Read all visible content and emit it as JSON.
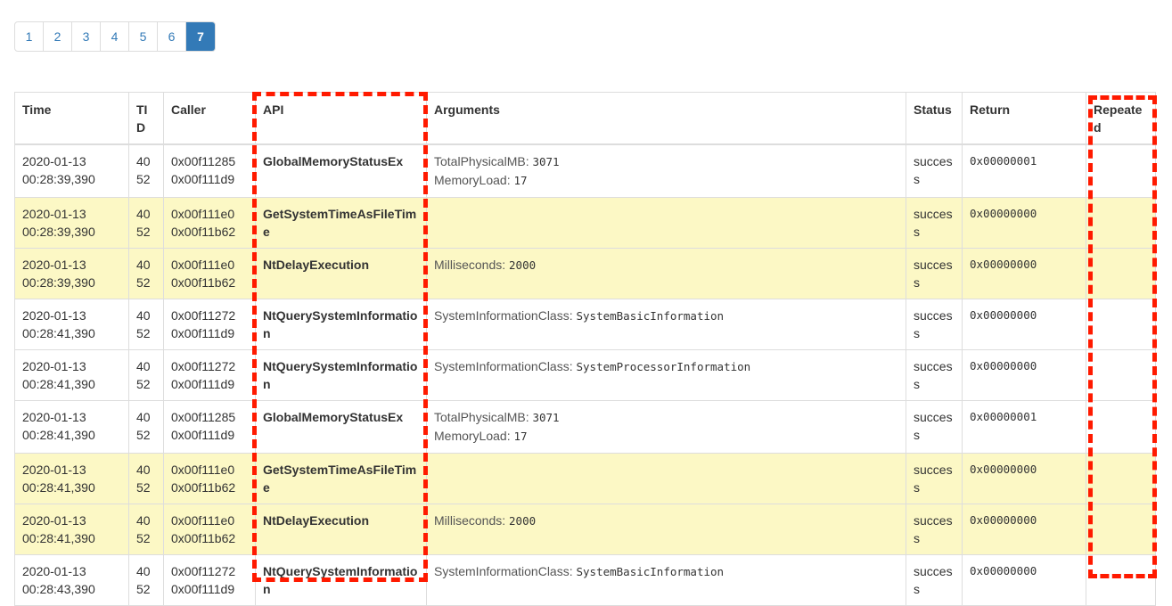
{
  "pagination": {
    "pages": [
      "1",
      "2",
      "3",
      "4",
      "5",
      "6",
      "7"
    ],
    "active": "7"
  },
  "table": {
    "headers": {
      "time": "Time",
      "tid": "TID",
      "caller": "Caller",
      "api": "API",
      "arguments": "Arguments",
      "status": "Status",
      "return": "Return",
      "repeated": "Repeated"
    },
    "rows": [
      {
        "highlight": false,
        "date": "2020-01-13",
        "time": "00:28:39,390",
        "tid_a": "40",
        "tid_b": "52",
        "caller_a": "0x00f11285",
        "caller_b": "0x00f111d9",
        "api": "GlobalMemoryStatusEx",
        "args": [
          {
            "name": "TotalPhysicalMB:",
            "value": "3071"
          },
          {
            "name": "MemoryLoad:",
            "value": "17"
          }
        ],
        "status": "success",
        "ret": "0x00000001",
        "repeated": ""
      },
      {
        "highlight": true,
        "date": "2020-01-13",
        "time": "00:28:39,390",
        "tid_a": "40",
        "tid_b": "52",
        "caller_a": "0x00f111e0",
        "caller_b": "0x00f11b62",
        "api": "GetSystemTimeAsFileTime",
        "args": [],
        "status": "success",
        "ret": "0x00000000",
        "repeated": ""
      },
      {
        "highlight": true,
        "date": "2020-01-13",
        "time": "00:28:39,390",
        "tid_a": "40",
        "tid_b": "52",
        "caller_a": "0x00f111e0",
        "caller_b": "0x00f11b62",
        "api": "NtDelayExecution",
        "args": [
          {
            "name": "Milliseconds:",
            "value": "2000"
          }
        ],
        "status": "success",
        "ret": "0x00000000",
        "repeated": ""
      },
      {
        "highlight": false,
        "date": "2020-01-13",
        "time": "00:28:41,390",
        "tid_a": "40",
        "tid_b": "52",
        "caller_a": "0x00f11272",
        "caller_b": "0x00f111d9",
        "api": "NtQuerySystemInformation",
        "args": [
          {
            "name": "SystemInformationClass:",
            "value": "SystemBasicInformation"
          }
        ],
        "status": "success",
        "ret": "0x00000000",
        "repeated": ""
      },
      {
        "highlight": false,
        "date": "2020-01-13",
        "time": "00:28:41,390",
        "tid_a": "40",
        "tid_b": "52",
        "caller_a": "0x00f11272",
        "caller_b": "0x00f111d9",
        "api": "NtQuerySystemInformation",
        "args": [
          {
            "name": "SystemInformationClass:",
            "value": "SystemProcessorInformation"
          }
        ],
        "status": "success",
        "ret": "0x00000000",
        "repeated": ""
      },
      {
        "highlight": false,
        "date": "2020-01-13",
        "time": "00:28:41,390",
        "tid_a": "40",
        "tid_b": "52",
        "caller_a": "0x00f11285",
        "caller_b": "0x00f111d9",
        "api": "GlobalMemoryStatusEx",
        "args": [
          {
            "name": "TotalPhysicalMB:",
            "value": "3071"
          },
          {
            "name": "MemoryLoad:",
            "value": "17"
          }
        ],
        "status": "success",
        "ret": "0x00000001",
        "repeated": ""
      },
      {
        "highlight": true,
        "date": "2020-01-13",
        "time": "00:28:41,390",
        "tid_a": "40",
        "tid_b": "52",
        "caller_a": "0x00f111e0",
        "caller_b": "0x00f11b62",
        "api": "GetSystemTimeAsFileTime",
        "args": [],
        "status": "success",
        "ret": "0x00000000",
        "repeated": ""
      },
      {
        "highlight": true,
        "date": "2020-01-13",
        "time": "00:28:41,390",
        "tid_a": "40",
        "tid_b": "52",
        "caller_a": "0x00f111e0",
        "caller_b": "0x00f11b62",
        "api": "NtDelayExecution",
        "args": [
          {
            "name": "Milliseconds:",
            "value": "2000"
          }
        ],
        "status": "success",
        "ret": "0x00000000",
        "repeated": ""
      },
      {
        "highlight": false,
        "date": "2020-01-13",
        "time": "00:28:43,390",
        "tid_a": "40",
        "tid_b": "52",
        "caller_a": "0x00f11272",
        "caller_b": "0x00f111d9",
        "api": "NtQuerySystemInformation",
        "args": [
          {
            "name": "SystemInformationClass:",
            "value": "SystemBasicInformation"
          }
        ],
        "status": "success",
        "ret": "0x00000000",
        "repeated": ""
      }
    ]
  },
  "colors": {
    "highlight_row": "#fcf8c5",
    "accent": "#337ab7",
    "annotation": "#ff1a00"
  }
}
